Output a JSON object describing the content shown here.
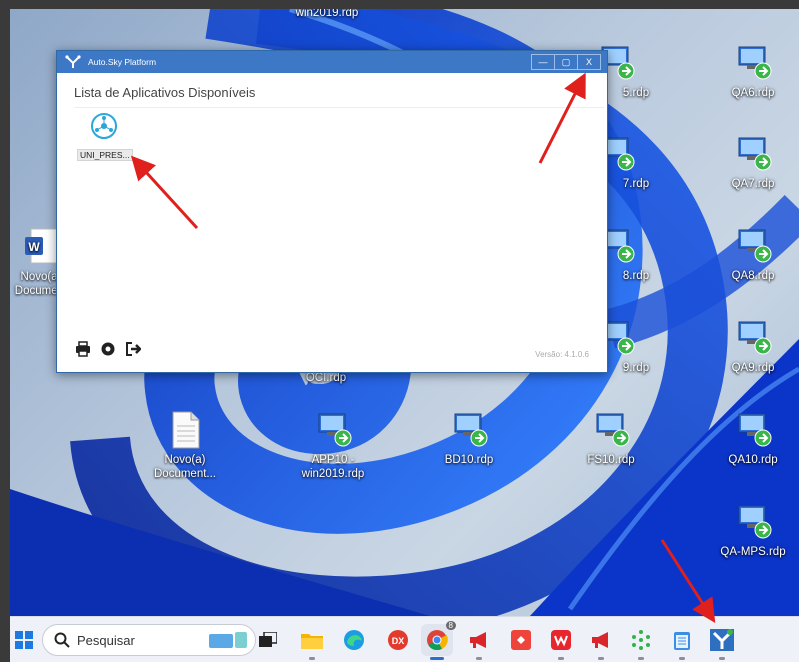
{
  "desktop": {
    "icons": [
      {
        "label": "win2019.rdp"
      },
      {
        "label": "QA6.rdp"
      },
      {
        "label": "QA7.rdp"
      },
      {
        "label": "QA8.rdp"
      },
      {
        "label": "QA9.rdp"
      },
      {
        "label": "QA10.rdp"
      },
      {
        "label": "QA-MPS.rdp"
      },
      {
        "label": "Novo(a)\nDocume..."
      },
      {
        "label": "OCI.rdp"
      },
      {
        "label": "Novo(a)\nDocument..."
      },
      {
        "label": "APP10 -\nwin2019.rdp"
      },
      {
        "label": "BD10.rdp"
      },
      {
        "label": "FS10.rdp"
      },
      {
        "label": "5.rdp"
      },
      {
        "label": "7.rdp"
      },
      {
        "label": "8.rdp"
      },
      {
        "label": "9.rdp"
      }
    ]
  },
  "app_window": {
    "title": "Auto.Sky Platform",
    "minimize": "—",
    "maximize": "▢",
    "close": "X",
    "section_title": "Lista de Aplicativos Disponíveis",
    "apps": [
      {
        "label": "UNI_PRES..."
      }
    ],
    "version": "Versão: 4.1.0.6"
  },
  "taskbar": {
    "search_placeholder": "Pesquisar",
    "chrome_badge": "8"
  },
  "colors": {
    "titlebar": "#3d78c6",
    "annotation_arrow": "#e0201c",
    "wallpaper_blue": "#1547d6"
  }
}
